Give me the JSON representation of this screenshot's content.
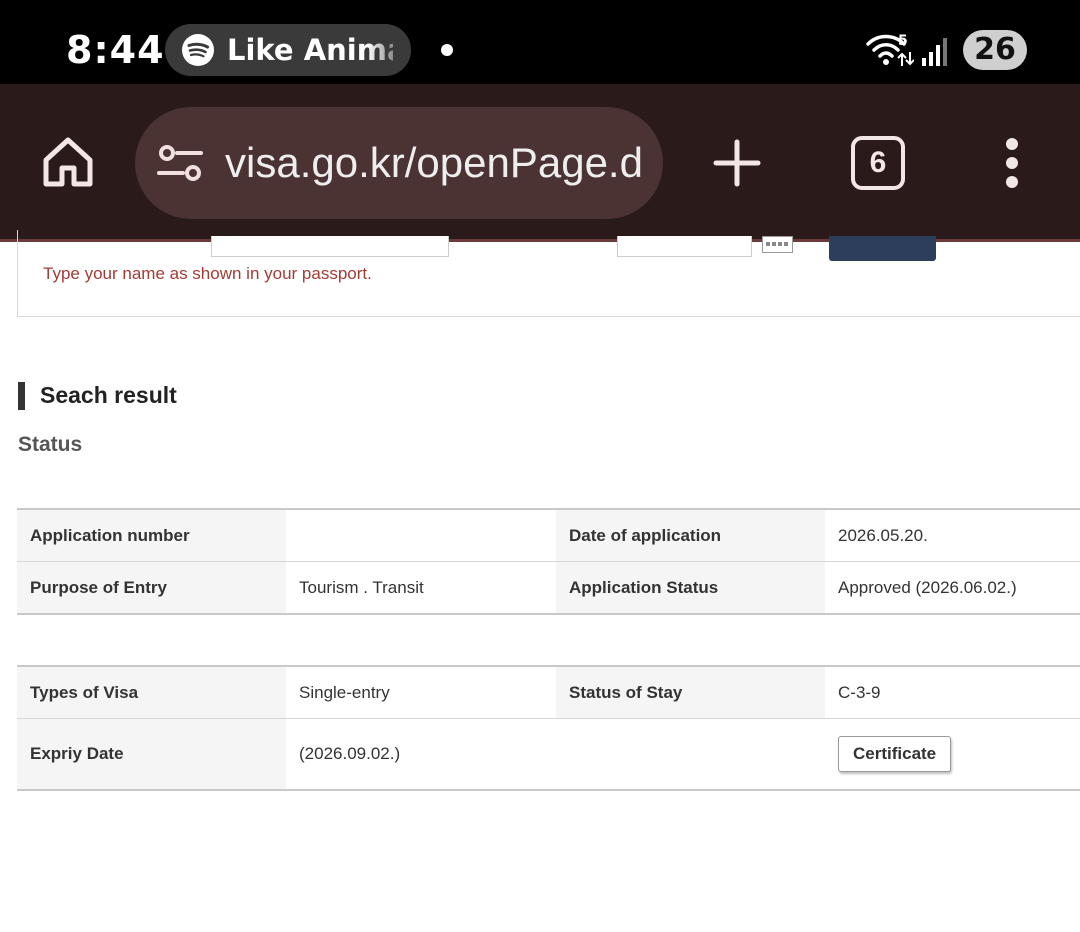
{
  "status_bar": {
    "time": "8:44",
    "media_title": "Like Anima",
    "wifi_badge": "5",
    "battery": "26"
  },
  "browser": {
    "url": "visa.go.kr/openPage.do",
    "tab_count": "6",
    "theme_color": "#2a1a19"
  },
  "form": {
    "name_hint": "Type your name as shown in your passport."
  },
  "result": {
    "section_title": "Seach result",
    "status_title": "Status",
    "table1": [
      {
        "label1": "Application number",
        "value1": "",
        "label2": "Date of application",
        "value2": "2026.05.20."
      },
      {
        "label1": "Purpose of Entry",
        "value1": "Tourism . Transit",
        "label2": "Application Status",
        "value2": "Approved (2026.06.02.)"
      }
    ],
    "table2": [
      {
        "label1": "Types of Visa",
        "value1": "Single-entry",
        "label2": "Status of Stay",
        "value2": "C-3-9"
      },
      {
        "label1": "Expriy Date",
        "value1": "(2026.09.02.)",
        "button": "Certificate"
      }
    ]
  }
}
